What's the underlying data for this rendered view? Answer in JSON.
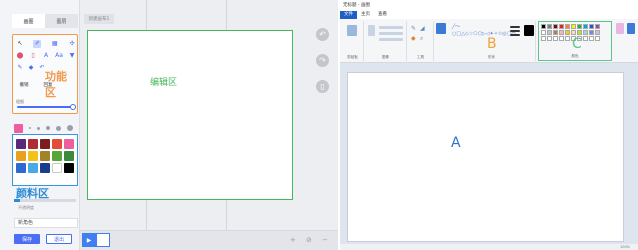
{
  "left_app": {
    "tabs": [
      "画图",
      "图层"
    ],
    "canvas_tag": "新建画布1",
    "function_label": "功能区",
    "tool_rows": [
      [
        "↖",
        "✐",
        "▦",
        "✣"
      ],
      [
        "⬤",
        "▯",
        "A",
        "Aa",
        "▼"
      ],
      [
        "✎",
        "◆",
        "↶"
      ],
      [
        "撤销",
        "回复"
      ]
    ],
    "slider_label": "粗细",
    "slider_level": 1.0,
    "palette_label": "颜料区",
    "palette_colors": [
      "#5a2a7a",
      "#b02a35",
      "#7e1d1d",
      "#e14d3a",
      "#ee5fa0",
      "#e8a020",
      "#f2c21b",
      "#a08428",
      "#56a63a",
      "#3b8a3a",
      "#2d6bd0",
      "#49a9e4",
      "#1b3e8c",
      "#ffffff",
      "#000000"
    ],
    "selected_color": "#ee5fa0",
    "palette_sub": "不透明度",
    "opacity_level": 0.1,
    "bottom_field": "新角色",
    "save_button": "保存",
    "exit_button": "退出",
    "edit_label": "编辑区",
    "zoom_controls": "+ ⊘ −"
  },
  "right_app": {
    "title": "无标题 - 画图",
    "menu_tabs": [
      "文件",
      "主页",
      "查看"
    ],
    "groups": [
      "剪贴板",
      "图像",
      "工具",
      "形状",
      "颜色"
    ],
    "shapes_glyphs": "╱〜○□△◇☆⬠⬡▷◁✦✧✩◎▢⬭",
    "label_a": "A",
    "label_b": "B",
    "label_c": "C",
    "palette_colors": [
      "#000000",
      "#7f7f7f",
      "#880015",
      "#ed1c24",
      "#ff7f27",
      "#fff200",
      "#22b14c",
      "#00a2e8",
      "#3f48cc",
      "#a349a4",
      "#ffffff",
      "#c3c3c3",
      "#b97a57",
      "#ffaec9",
      "#ffc90e",
      "#efe4b0",
      "#b5e61d",
      "#99d9ea",
      "#7092be",
      "#c8bfe7",
      "#ffffff",
      "#ffffff",
      "#ffffff",
      "#ffffff",
      "#ffffff",
      "#ffffff",
      "#ffffff",
      "#ffffff",
      "#ffffff",
      "#ffffff"
    ],
    "status_text": "100%"
  }
}
